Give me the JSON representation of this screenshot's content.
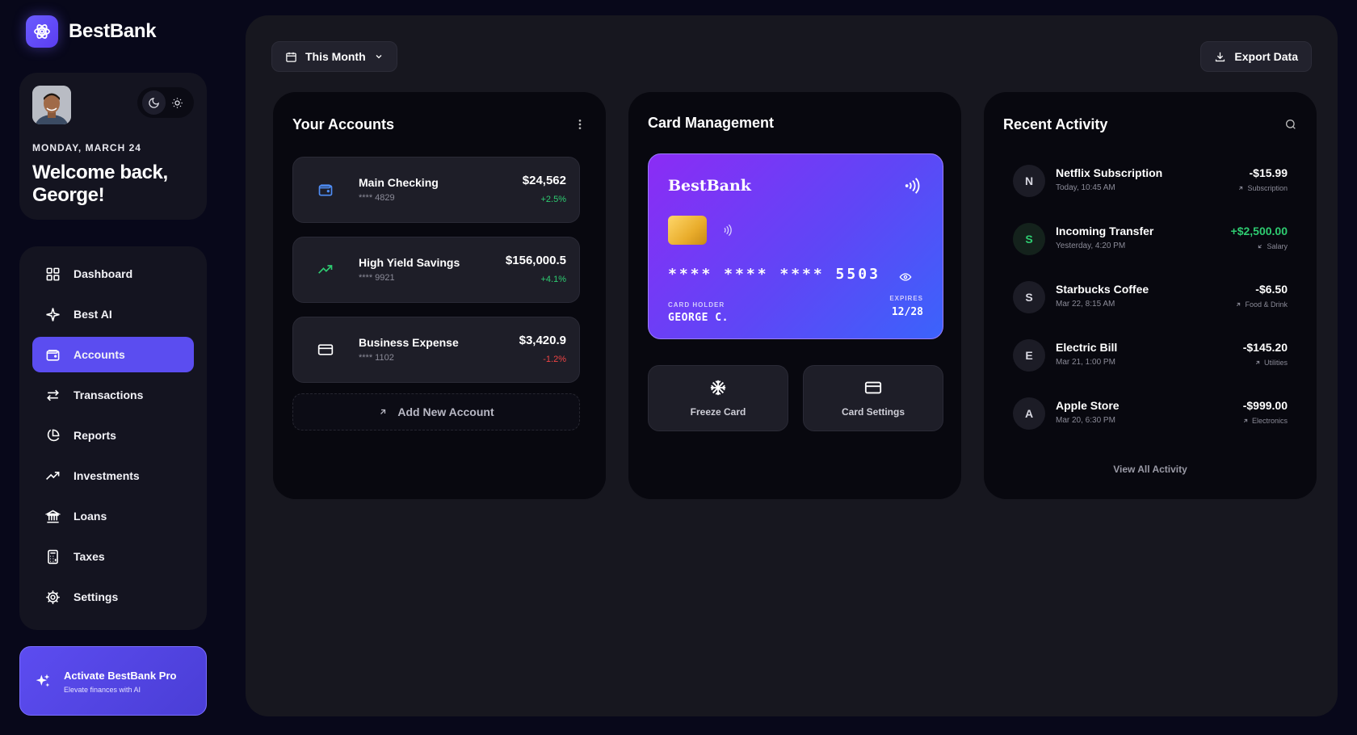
{
  "brand": {
    "name": "BestBank"
  },
  "profile": {
    "date": "MONDAY, MARCH 24",
    "welcome": "Welcome back, George!"
  },
  "nav": {
    "items": [
      {
        "label": "Dashboard",
        "icon": "dashboard-icon"
      },
      {
        "label": "Best AI",
        "icon": "sparkle-icon"
      },
      {
        "label": "Accounts",
        "icon": "wallet-icon",
        "active": true
      },
      {
        "label": "Transactions",
        "icon": "transfer-icon"
      },
      {
        "label": "Reports",
        "icon": "pie-chart-icon"
      },
      {
        "label": "Investments",
        "icon": "trending-up-icon"
      },
      {
        "label": "Loans",
        "icon": "bank-icon"
      },
      {
        "label": "Taxes",
        "icon": "calculator-icon"
      },
      {
        "label": "Settings",
        "icon": "gear-icon"
      }
    ]
  },
  "promo": {
    "title": "Activate BestBank Pro",
    "subtitle": "Elevate finances with AI"
  },
  "toolbar": {
    "period": "This Month",
    "export": "Export Data"
  },
  "accounts": {
    "title": "Your Accounts",
    "items": [
      {
        "name": "Main Checking",
        "number": "**** 4829",
        "balance": "$24,562",
        "change": "+2.5%"
      },
      {
        "name": "High Yield Savings",
        "number": "**** 9921",
        "balance": "$156,000.5",
        "change": "+4.1%"
      },
      {
        "name": "Business Expense",
        "number": "**** 1102",
        "balance": "$3,420.9",
        "change": "-1.2%"
      }
    ],
    "add_label": "Add New Account"
  },
  "card": {
    "title": "Card Management",
    "brand": "BestBank",
    "number": "**** **** **** 5503",
    "holder_label": "CARD HOLDER",
    "holder": "GEORGE C.",
    "expires_label": "EXPIRES",
    "expires": "12/28",
    "freeze_label": "Freeze Card",
    "settings_label": "Card Settings"
  },
  "activity": {
    "title": "Recent Activity",
    "items": [
      {
        "initial": "N",
        "name": "Netflix Subscription",
        "time": "Today, 10:45 AM",
        "amount": "-$15.99",
        "category": "Subscription"
      },
      {
        "initial": "S",
        "name": "Incoming Transfer",
        "time": "Yesterday, 4:20 PM",
        "amount": "+$2,500.00",
        "category": "Salary"
      },
      {
        "initial": "S",
        "name": "Starbucks Coffee",
        "time": "Mar 22, 8:15 AM",
        "amount": "-$6.50",
        "category": "Food & Drink"
      },
      {
        "initial": "E",
        "name": "Electric Bill",
        "time": "Mar 21, 1:00 PM",
        "amount": "-$145.20",
        "category": "Utilities"
      },
      {
        "initial": "A",
        "name": "Apple Store",
        "time": "Mar 20, 6:30 PM",
        "amount": "-$999.00",
        "category": "Electronics"
      }
    ],
    "view_all": "View All Activity"
  },
  "colors": {
    "accent": "#5b4df0",
    "positive": "#2ecc71",
    "negative": "#ef4444",
    "background": "#08081a",
    "panel": "#17171f"
  }
}
